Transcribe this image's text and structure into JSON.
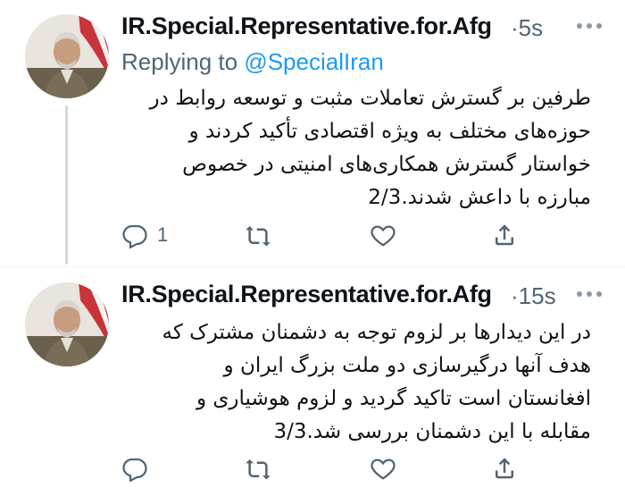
{
  "tweets": [
    {
      "display_name": "IR.Special.Representative.for.Afg",
      "time": "5s",
      "replying_label": "Replying to",
      "replying_handle": "@SpecialIran",
      "body_lines": [
        "طرفین بر گسترش تعاملات مثبت و توسعه روابط در",
        "حوزه‌های مختلف به ویژه  اقتصادی تأکید کردند و",
        "خواستار گسترش همکاری‌های امنیتی در خصوص",
        "مبارزه با داعش شدند.2/3"
      ],
      "reply_count": "1",
      "retweet_count": "",
      "like_count": ""
    },
    {
      "display_name": "IR.Special.Representative.for.Afg",
      "time": "15s",
      "body_lines": [
        "در این دیدارها بر لزوم توجه به دشمنان مشترک که",
        "هدف آنها درگیرسازی دو ملت بزرگ ایران و",
        "افغانستان است تاکید گردید و لزوم هوشیاری و",
        "مقابله با این دشمنان بررسی شد.3/3"
      ],
      "reply_count": "",
      "retweet_count": "",
      "like_count": ""
    }
  ],
  "separator": "·",
  "icons": [
    "reply-icon",
    "retweet-icon",
    "like-icon",
    "share-icon",
    "more-icon"
  ],
  "colors": {
    "link": "#1d9bf0",
    "secondary": "#536471",
    "text": "#0f1419",
    "thread_line": "#cfd9de"
  }
}
